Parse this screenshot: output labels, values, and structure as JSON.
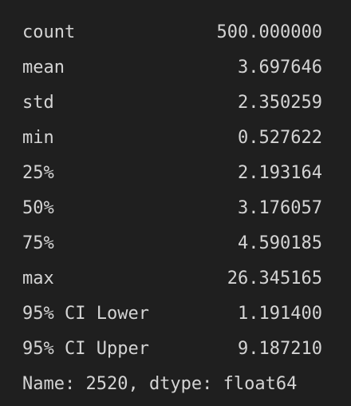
{
  "describe": {
    "rows": [
      {
        "label": "count",
        "value": "500.000000"
      },
      {
        "label": "mean",
        "value": "3.697646"
      },
      {
        "label": "std",
        "value": "2.350259"
      },
      {
        "label": "min",
        "value": "0.527622"
      },
      {
        "label": "25%",
        "value": "2.193164"
      },
      {
        "label": "50%",
        "value": "3.176057"
      },
      {
        "label": "75%",
        "value": "4.590185"
      },
      {
        "label": "max",
        "value": "26.345165"
      },
      {
        "label": "95% CI Lower",
        "value": "1.191400"
      },
      {
        "label": "95% CI Upper",
        "value": "9.187210"
      }
    ],
    "footer": "Name: 2520, dtype: float64"
  }
}
